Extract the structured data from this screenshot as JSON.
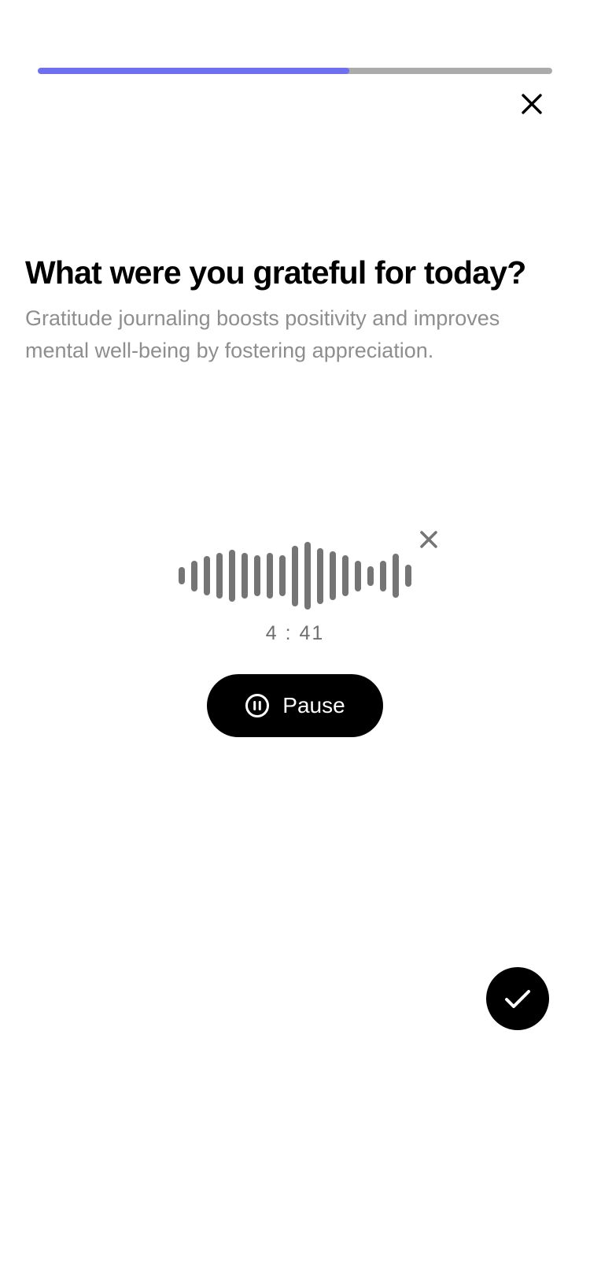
{
  "progress": {
    "fraction": 0.605,
    "fill_color": "#6f6ff0",
    "track_color": "#ababab"
  },
  "header": {
    "close_icon": "close-icon"
  },
  "prompt": {
    "title": "What were you grateful for today?",
    "subtitle": "Gratitude journaling boosts positivity and improves mental well-being by fostering appreciation."
  },
  "recording": {
    "levels": [
      0.25,
      0.45,
      0.58,
      0.68,
      0.77,
      0.68,
      0.61,
      0.68,
      0.61,
      0.9,
      1.0,
      0.82,
      0.72,
      0.61,
      0.45,
      0.29,
      0.45,
      0.65,
      0.33
    ],
    "bar_color": "#757575",
    "discard_icon": "close-icon",
    "elapsed": "4 : 41",
    "pause_label": "Pause",
    "pause_icon": "pause-circle-icon"
  },
  "actions": {
    "confirm_icon": "checkmark-icon"
  }
}
